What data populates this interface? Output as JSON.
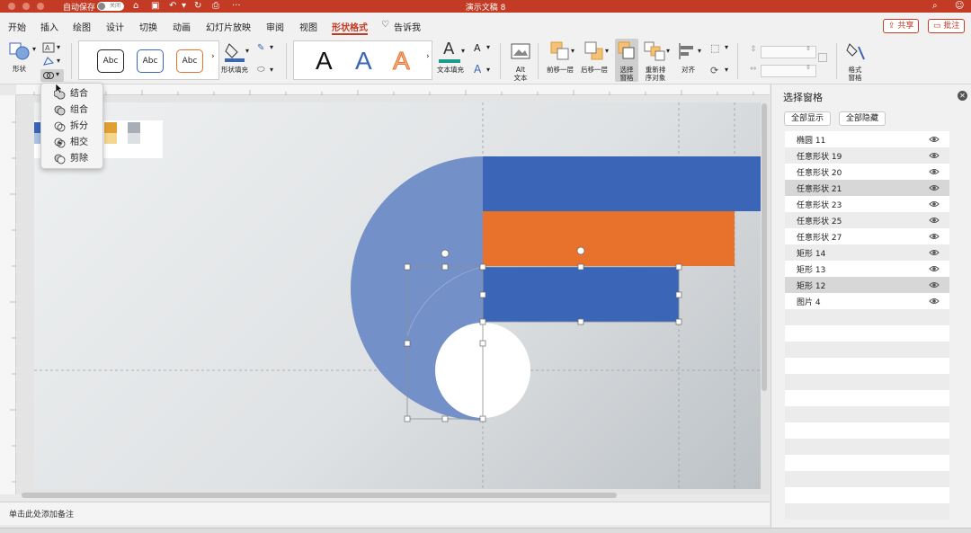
{
  "window": {
    "autosave_label": "自动保存",
    "autosave_toggle": "关闭",
    "title": "演示文稿 8"
  },
  "menu": {
    "tabs": [
      "开始",
      "插入",
      "绘图",
      "设计",
      "切换",
      "动画",
      "幻灯片放映",
      "审阅",
      "视图",
      "形状格式"
    ],
    "active_tab": "形状格式",
    "tell_me": "告诉我",
    "share": "共享",
    "comments": "批注"
  },
  "ribbon": {
    "shapes_label": "形状",
    "style_samples": [
      "Abc",
      "Abc",
      "Abc"
    ],
    "shape_fill_label": "形状填充",
    "wordart_samples": [
      "A",
      "A",
      "A"
    ],
    "text_fill_label": "文本填充",
    "alt_text_label": "Alt 文本",
    "bring_forward_label": "前移一层",
    "send_backward_label": "后移一层",
    "selection_pane_label": "选择窗格",
    "reorder_label": "重新排序对象",
    "align_label": "对齐",
    "format_pane_label": "格式窗格"
  },
  "merge_menu": {
    "items": [
      {
        "label": "结合",
        "icon": "union-icon"
      },
      {
        "label": "组合",
        "icon": "combine-icon"
      },
      {
        "label": "拆分",
        "icon": "fragment-icon"
      },
      {
        "label": "相交",
        "icon": "intersect-icon"
      },
      {
        "label": "剪除",
        "icon": "subtract-icon"
      }
    ]
  },
  "selection_pane": {
    "title": "选择窗格",
    "show_all": "全部显示",
    "hide_all": "全部隐藏",
    "items": [
      {
        "label": "椭圆 11",
        "selected": false
      },
      {
        "label": "任意形状 19",
        "selected": false
      },
      {
        "label": "任意形状 20",
        "selected": false
      },
      {
        "label": "任意形状 21",
        "selected": true
      },
      {
        "label": "任意形状 23",
        "selected": false
      },
      {
        "label": "任意形状 25",
        "selected": false
      },
      {
        "label": "任意形状 27",
        "selected": false
      },
      {
        "label": "矩形 14",
        "selected": false
      },
      {
        "label": "矩形 13",
        "selected": false
      },
      {
        "label": "矩形 12",
        "selected": true
      },
      {
        "label": "图片 4",
        "selected": false
      }
    ]
  },
  "notes": {
    "placeholder": "单击此处添加备注"
  },
  "colors": {
    "accent": "#c43b25",
    "blue_shape": "#3b66b8",
    "circle_blue": "#7490c8",
    "orange_shape": "#e8722b",
    "text_fill_accent": "#1a9b8c"
  }
}
